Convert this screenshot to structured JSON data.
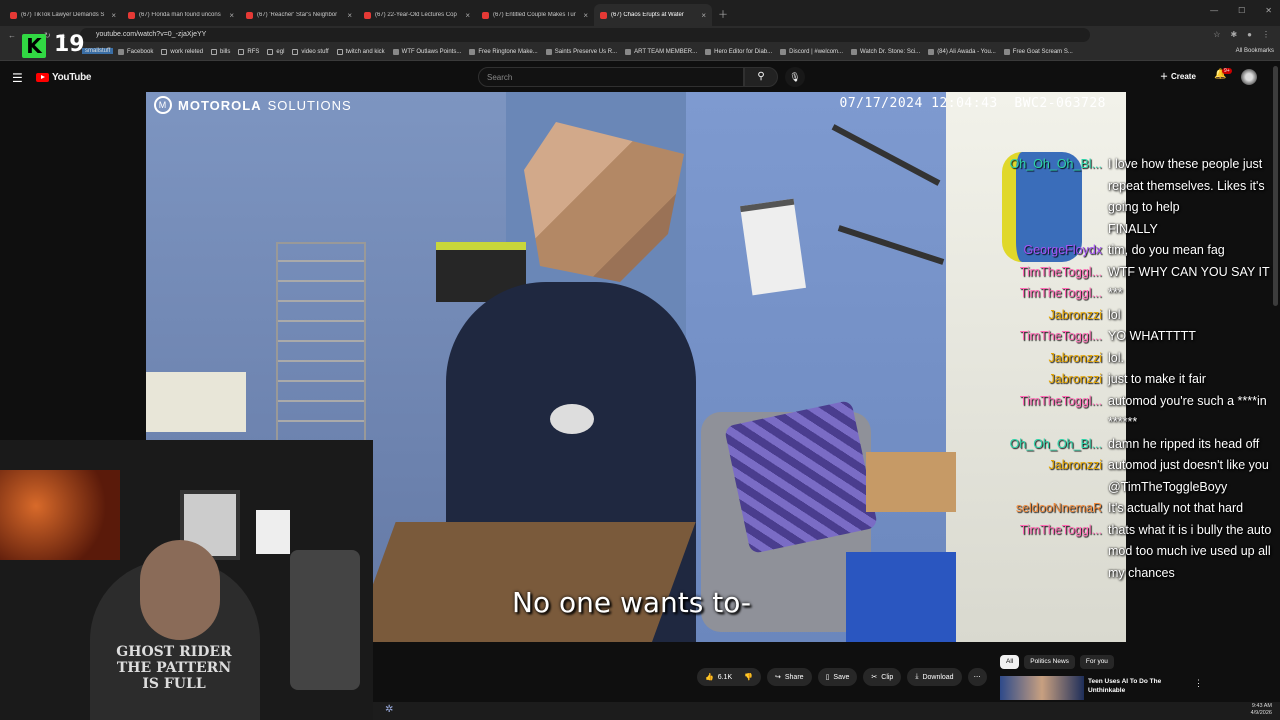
{
  "browser": {
    "tabs": [
      {
        "title": "(67) TikTok Lawyer Demands S",
        "active": false
      },
      {
        "title": "(67) Florida man found uncons",
        "active": false
      },
      {
        "title": "(67) 'Reacher' Star's Neighbor",
        "active": false
      },
      {
        "title": "(67) 22-Year-Old Lectures Cop",
        "active": false
      },
      {
        "title": "(67) Entitled Couple Makes Tur",
        "active": false
      },
      {
        "title": "(67) Chaos Erupts at Water",
        "active": true
      }
    ],
    "url": "youtube.com/watch?v=0_-zjaXjeYY",
    "bookmarks": [
      {
        "label": "Facebook",
        "folder": false
      },
      {
        "label": "work releted",
        "folder": true
      },
      {
        "label": "bills",
        "folder": true
      },
      {
        "label": "RFS",
        "folder": true
      },
      {
        "label": "egl",
        "folder": true
      },
      {
        "label": "video stuff",
        "folder": true
      },
      {
        "label": "twitch and kick",
        "folder": true
      },
      {
        "label": "WTF Outlaws Points...",
        "folder": false
      },
      {
        "label": "Free Ringtone Make...",
        "folder": false
      },
      {
        "label": "Saints Preserve Us R...",
        "folder": false
      },
      {
        "label": "ART TEAM MEMBER...",
        "folder": false
      },
      {
        "label": "Hero Editor for Diab...",
        "folder": false
      },
      {
        "label": "Discord | #welcom...",
        "folder": false
      },
      {
        "label": "Watch Dr. Stone: Sci...",
        "folder": false
      },
      {
        "label": "(84) Ali Awada - You...",
        "folder": false
      },
      {
        "label": "Free Goat Scream S...",
        "folder": false
      }
    ],
    "all_bookmarks": "All Bookmarks",
    "smallstuff": "smallstuff"
  },
  "overlay": {
    "k_letter": "K",
    "number": "19"
  },
  "youtube": {
    "logo": "YouTube",
    "search_placeholder": "Search",
    "create": "Create",
    "notif_count": "9+"
  },
  "video": {
    "brand_bold": "MOTOROLA",
    "brand_light": "SOLUTIONS",
    "timestamp": "07/17/2024 12:04:43",
    "camera_id": "BWC2-063728",
    "caption": "No one wants to-"
  },
  "webcam": {
    "shirt_line1": "GHOST RIDER",
    "shirt_line2": "THE PATTERN",
    "shirt_line3": "IS FULL"
  },
  "chat": [
    {
      "user": "Oh_Oh_Oh_Bl...",
      "color": "#2ed3a8",
      "msg": "I love how these people just repeat themselves. Likes it's going to help"
    },
    {
      "user": "",
      "color": "#2ed3a8",
      "msg": "FINALLY"
    },
    {
      "user": "GeorgeFloydx",
      "color": "#a553f5",
      "msg": "tim, do you mean fag"
    },
    {
      "user": "TimTheToggl...",
      "color": "#ff69b4",
      "msg": "WTF WHY CAN YOU SAY IT"
    },
    {
      "user": "TimTheToggl...",
      "color": "#ff69b4",
      "msg": "***"
    },
    {
      "user": "Jabronzzi",
      "color": "#e6a600",
      "msg": "lol"
    },
    {
      "user": "TimTheToggl...",
      "color": "#ff69b4",
      "msg": "YO WHATTTTT"
    },
    {
      "user": "Jabronzzi",
      "color": "#e6a600",
      "msg": "lol."
    },
    {
      "user": "Jabronzzi",
      "color": "#e6a600",
      "msg": "just to make it fair"
    },
    {
      "user": "TimTheToggl...",
      "color": "#ff69b4",
      "msg": "automod you're such a ****in ******"
    },
    {
      "user": "Oh_Oh_Oh_Bl...",
      "color": "#2ed3a8",
      "msg": "damn he ripped its head off"
    },
    {
      "user": "Jabronzzi",
      "color": "#e6a600",
      "msg": "automod just doesn't like you @TimTheToggleBoyy"
    },
    {
      "user": "seldooNnemaR",
      "color": "#f08b3e",
      "msg": "It's actually not that hard"
    },
    {
      "user": "TimTheToggl...",
      "color": "#ff69b4",
      "msg": "thats what it is i bully the auto mod too much ive used up all my chances"
    }
  ],
  "actions": {
    "likes": "6.1K",
    "share": "Share",
    "save": "Save",
    "clip": "Clip",
    "download": "Download"
  },
  "chips": [
    "All",
    "Politics News",
    "For you"
  ],
  "recommendation": {
    "title": "Teen Uses AI To Do The Unthinkable"
  },
  "clock": {
    "time": "9:43 AM",
    "date": "4/9/2026"
  }
}
